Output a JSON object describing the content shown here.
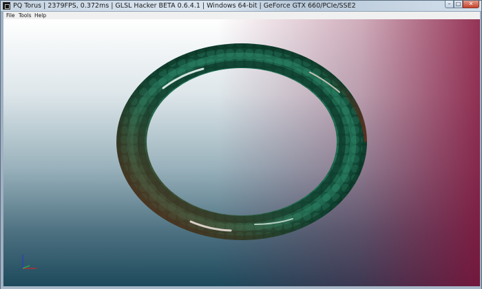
{
  "window": {
    "title": "PQ Torus | 2379FPS, 0.372ms | GLSL Hacker BETA 0.6.4.1 | Windows 64-bit | GeForce GTX 660/PCIe/SSE2",
    "controls": {
      "minimize": "–",
      "maximize": "□",
      "close": "✕"
    }
  },
  "menu": {
    "items": [
      {
        "label": "File"
      },
      {
        "label": "Tools"
      },
      {
        "label": "Help"
      }
    ]
  },
  "scene": {
    "object": "torus",
    "torus_color": "#1f6f52",
    "torus_highlight_color": "#7a2a1e",
    "background_top": "#ffffff",
    "background_bottom_left": "#1d4a5c",
    "background_bottom_right": "#7a1840"
  }
}
